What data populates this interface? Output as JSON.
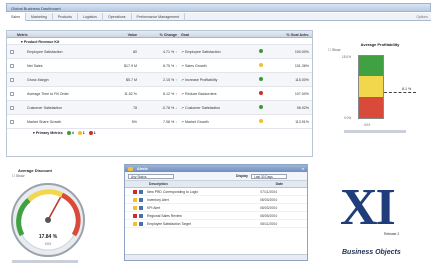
{
  "window": {
    "title": "Global Business Dashboard"
  },
  "tabs": [
    "Sales",
    "Marketing",
    "Products",
    "Logistics",
    "Operations",
    "Performance Management"
  ],
  "tab_options": "Options",
  "kpi": {
    "headers": [
      "Metric",
      "Value",
      "% Change",
      "Goal",
      "",
      "% Goal Achv."
    ],
    "group_label": "Product Revenue Kit",
    "rows": [
      {
        "metric": "Employee Satisfaction",
        "value": "80",
        "change": "4.71 %",
        "goal": "Employee Satisfaction",
        "status_color": "#3a9a3a",
        "achv": "100.00%"
      },
      {
        "metric": "Net Sales",
        "value": "$17.9 M",
        "change": "8.75 %",
        "goal": "Sales Growth",
        "status_color": "#f2c12e",
        "achv": "101.36%"
      },
      {
        "metric": "Gross Margin",
        "value": "$5.7 M",
        "change": "2.15 %",
        "goal": "Increase Profitability",
        "status_color": "#3a9a3a",
        "achv": "115.00%"
      },
      {
        "metric": "Average Time to Fill Order",
        "value": "11.52 %",
        "change": "8.12 %",
        "goal": "Reduce Backorders",
        "status_color": "#d02b2b",
        "achv": "107.00%"
      },
      {
        "metric": "Customer Satisfaction",
        "value": "78",
        "change": "-0.78 %",
        "goal": "Customer Satisfaction",
        "status_color": "#3a9a3a",
        "achv": "96.92%"
      },
      {
        "metric": "Market Share Growth",
        "value": "5%",
        "change": "7.08 %",
        "goal": "Market Growth",
        "status_color": "#f2c12e",
        "achv": "113.91%"
      }
    ],
    "footer_label": "Primary Metrics",
    "footer_counts": [
      "4",
      "1",
      "1"
    ]
  },
  "profitability": {
    "title": "Average Profitability",
    "checkbox_label": "Show",
    "value_label": "8.1 %",
    "bottom_label": "XXX",
    "scale_top": "15.0%",
    "scale_bottom": "0.0%",
    "colors": {
      "high": "#3fa142",
      "mid": "#f2d64b",
      "low": "#d94a3a"
    }
  },
  "gauge": {
    "title": "Average Discount",
    "checkbox_label": "Show",
    "value_text": "17.84 %",
    "sub_label": "XXX",
    "fraction": 0.62
  },
  "alerts": {
    "title": "Alerts",
    "filter_value": "Any Status",
    "display_label": "Display",
    "display_value": "Last 30 Days",
    "headers": [
      "",
      "Description",
      "Date"
    ],
    "rows": [
      {
        "desc": "New PRD Corresponding to Login",
        "date": "07/11/2004",
        "color": "#d02b2b"
      },
      {
        "desc": "Inventory Alert",
        "date": "08/03/2004",
        "color": "#f2c12e"
      },
      {
        "desc": "KPI Alert",
        "date": "08/03/2004",
        "color": "#f2c12e"
      },
      {
        "desc": "Regional Sales Review",
        "date": "08/05/2004",
        "color": "#d02b2b"
      },
      {
        "desc": "Employee Satisfaction Target",
        "date": "08/11/2004",
        "color": "#f2c12e"
      }
    ]
  },
  "branding": {
    "xi": "XI",
    "release": "Release 2",
    "company": "Business Objects",
    "colors": {
      "logo": "#1f3d7a"
    }
  }
}
